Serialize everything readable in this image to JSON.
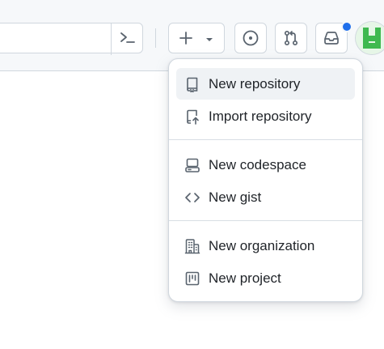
{
  "header": {
    "icons": {
      "command_palette": "command-palette-icon",
      "create_new": "plus-icon",
      "create_dropdown": "triangle-down-icon",
      "issues": "issue-opened-icon",
      "pull_requests": "git-pull-request-icon",
      "inbox": "inbox-icon"
    },
    "notification_dot_color": "#1f6feb",
    "avatar_color": "#3fb950"
  },
  "create_menu": {
    "groups": [
      {
        "items": [
          {
            "label": "New repository",
            "icon": "repo-icon",
            "active": true
          },
          {
            "label": "Import repository",
            "icon": "repo-push-icon",
            "active": false
          }
        ]
      },
      {
        "items": [
          {
            "label": "New codespace",
            "icon": "codespaces-icon",
            "active": false
          },
          {
            "label": "New gist",
            "icon": "code-icon",
            "active": false
          }
        ]
      },
      {
        "items": [
          {
            "label": "New organization",
            "icon": "organization-icon",
            "active": false
          },
          {
            "label": "New project",
            "icon": "project-icon",
            "active": false
          }
        ]
      }
    ]
  }
}
